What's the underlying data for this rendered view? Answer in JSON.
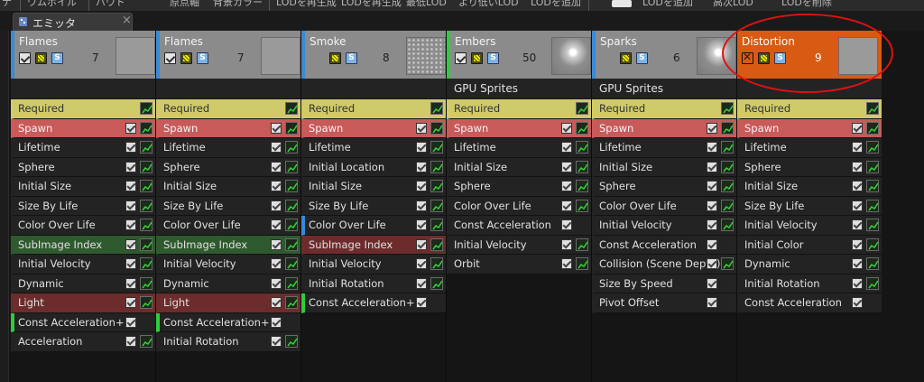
{
  "toolbar": {
    "items": [
      "ナ",
      "ワムボイル",
      "バウド",
      "原点軸",
      "背景カラー",
      "LODを再生成",
      "LODを再生成",
      "最低LOD",
      "より低いLOD",
      "LODを追加",
      "LODを追加",
      "高次LOD",
      "LODを削除"
    ]
  },
  "tab": {
    "label": "エミッタ",
    "close": "×"
  },
  "emitters": [
    {
      "name": "Flames",
      "count": "7",
      "type_label": "",
      "thumb": "flat",
      "enabled": true,
      "modules": [
        {
          "label": "Required",
          "style": "req",
          "has_checkbox": false
        },
        {
          "label": "Spawn",
          "style": "spawn",
          "has_checkbox": true
        },
        {
          "label": "Lifetime",
          "style": "",
          "has_checkbox": true
        },
        {
          "label": "Sphere",
          "style": "",
          "has_checkbox": true
        },
        {
          "label": "Initial Size",
          "style": "",
          "has_checkbox": true
        },
        {
          "label": "Size By Life",
          "style": "",
          "has_checkbox": true
        },
        {
          "label": "Color Over Life",
          "style": "",
          "has_checkbox": true
        },
        {
          "label": "SubImage Index",
          "style": "subimg",
          "has_checkbox": true
        },
        {
          "label": "Initial Velocity",
          "style": "",
          "has_checkbox": true
        },
        {
          "label": "Dynamic",
          "style": "",
          "has_checkbox": true
        },
        {
          "label": "Light",
          "style": "light",
          "has_checkbox": true
        },
        {
          "label": "Const Acceleration+",
          "style": "greenmark",
          "has_checkbox": true,
          "no_graph": true
        },
        {
          "label": "Acceleration",
          "style": "",
          "has_checkbox": true
        }
      ]
    },
    {
      "name": "Flames",
      "count": "7",
      "type_label": "",
      "thumb": "flat",
      "enabled": true,
      "modules": [
        {
          "label": "Required",
          "style": "req",
          "has_checkbox": false
        },
        {
          "label": "Spawn",
          "style": "spawn",
          "has_checkbox": true
        },
        {
          "label": "Lifetime",
          "style": "",
          "has_checkbox": true
        },
        {
          "label": "Sphere",
          "style": "",
          "has_checkbox": true
        },
        {
          "label": "Initial Size",
          "style": "",
          "has_checkbox": true
        },
        {
          "label": "Size By Life",
          "style": "",
          "has_checkbox": true
        },
        {
          "label": "Color Over Life",
          "style": "",
          "has_checkbox": true
        },
        {
          "label": "SubImage Index",
          "style": "subimg",
          "has_checkbox": true
        },
        {
          "label": "Initial Velocity",
          "style": "",
          "has_checkbox": true
        },
        {
          "label": "Dynamic",
          "style": "",
          "has_checkbox": true
        },
        {
          "label": "Light",
          "style": "light",
          "has_checkbox": true
        },
        {
          "label": "Const Acceleration+",
          "style": "greenmark",
          "has_checkbox": true,
          "no_graph": true
        },
        {
          "label": "Initial Rotation",
          "style": "",
          "has_checkbox": true
        }
      ]
    },
    {
      "name": "Smoke",
      "count": "8",
      "type_label": "",
      "thumb": "dots",
      "enabled": true,
      "no_checkbox": true,
      "modules": [
        {
          "label": "Required",
          "style": "req",
          "has_checkbox": false
        },
        {
          "label": "Spawn",
          "style": "spawn",
          "has_checkbox": true
        },
        {
          "label": "Lifetime",
          "style": "",
          "has_checkbox": true
        },
        {
          "label": "Initial Location",
          "style": "",
          "has_checkbox": true
        },
        {
          "label": "Initial Size",
          "style": "",
          "has_checkbox": true
        },
        {
          "label": "Size By Life",
          "style": "",
          "has_checkbox": true
        },
        {
          "label": "Color Over Life",
          "style": "bluemark",
          "has_checkbox": true
        },
        {
          "label": "SubImage Index",
          "style": "light",
          "has_checkbox": true
        },
        {
          "label": "Initial Velocity",
          "style": "",
          "has_checkbox": true
        },
        {
          "label": "Initial Rotation",
          "style": "",
          "has_checkbox": true
        },
        {
          "label": "Const Acceleration+",
          "style": "greenmark",
          "has_checkbox": true,
          "no_graph": true
        }
      ]
    },
    {
      "name": "Embers",
      "count": "50",
      "type_label": "GPU Sprites",
      "thumb": "glow",
      "enabled": true,
      "green_edge": true,
      "modules": [
        {
          "label": "Required",
          "style": "req",
          "has_checkbox": false
        },
        {
          "label": "Spawn",
          "style": "spawn",
          "has_checkbox": true
        },
        {
          "label": "Lifetime",
          "style": "",
          "has_checkbox": true
        },
        {
          "label": "Initial Size",
          "style": "",
          "has_checkbox": true
        },
        {
          "label": "Sphere",
          "style": "",
          "has_checkbox": true
        },
        {
          "label": "Color Over Life",
          "style": "",
          "has_checkbox": true
        },
        {
          "label": "Const Acceleration",
          "style": "",
          "has_checkbox": true,
          "no_graph": true
        },
        {
          "label": "Initial Velocity",
          "style": "",
          "has_checkbox": true
        },
        {
          "label": "Orbit",
          "style": "",
          "has_checkbox": true
        }
      ]
    },
    {
      "name": "Sparks",
      "count": "6",
      "type_label": "GPU Sprites",
      "thumb": "glow",
      "enabled": true,
      "no_checkbox": true,
      "modules": [
        {
          "label": "Required",
          "style": "req",
          "has_checkbox": false
        },
        {
          "label": "Spawn",
          "style": "spawn",
          "has_checkbox": true
        },
        {
          "label": "Lifetime",
          "style": "",
          "has_checkbox": true
        },
        {
          "label": "Initial Size",
          "style": "",
          "has_checkbox": true
        },
        {
          "label": "Sphere",
          "style": "",
          "has_checkbox": true
        },
        {
          "label": "Color Over Life",
          "style": "",
          "has_checkbox": true
        },
        {
          "label": "Initial Velocity",
          "style": "",
          "has_checkbox": true
        },
        {
          "label": "Const Acceleration",
          "style": "",
          "has_checkbox": true,
          "no_graph": true
        },
        {
          "label": "Collision (Scene Depth)",
          "style": "",
          "has_checkbox": true
        },
        {
          "label": "Size By Speed",
          "style": "",
          "has_checkbox": true,
          "no_graph": true
        },
        {
          "label": "Pivot Offset",
          "style": "",
          "has_checkbox": true,
          "no_graph": true
        }
      ]
    },
    {
      "name": "Distortion",
      "count": "9",
      "type_label": "",
      "thumb": "flat",
      "enabled": false,
      "distortion": true,
      "modules": [
        {
          "label": "Required",
          "style": "req",
          "has_checkbox": false
        },
        {
          "label": "Spawn",
          "style": "spawn",
          "has_checkbox": true
        },
        {
          "label": "Lifetime",
          "style": "",
          "has_checkbox": true
        },
        {
          "label": "Sphere",
          "style": "",
          "has_checkbox": true
        },
        {
          "label": "Initial Size",
          "style": "",
          "has_checkbox": true
        },
        {
          "label": "Size By Life",
          "style": "",
          "has_checkbox": true
        },
        {
          "label": "Initial Velocity",
          "style": "",
          "has_checkbox": true
        },
        {
          "label": "Initial Color",
          "style": "",
          "has_checkbox": true
        },
        {
          "label": "Dynamic",
          "style": "",
          "has_checkbox": true
        },
        {
          "label": "Initial Rotation",
          "style": "",
          "has_checkbox": true
        },
        {
          "label": "Const Acceleration",
          "style": "",
          "has_checkbox": true,
          "no_graph": true
        }
      ]
    }
  ],
  "colors": {
    "required": "#cfca6a",
    "spawn": "#c85a5a",
    "subimage": "#2f5a2f",
    "light": "#6d2c2c",
    "emitter_header": "#8b8b8b",
    "distortion_header": "#d95a12",
    "highlight_circle": "#e01010"
  }
}
